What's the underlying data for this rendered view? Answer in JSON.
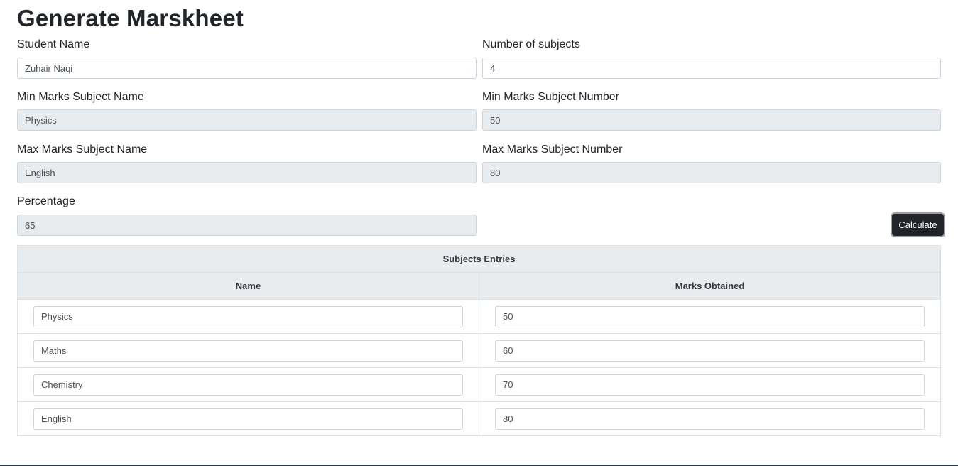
{
  "page": {
    "title": "Generate Marskheet"
  },
  "form": {
    "student_name": {
      "label": "Student Name",
      "value": "Zuhair Naqi"
    },
    "num_subjects": {
      "label": "Number of subjects",
      "value": "4"
    },
    "min_subject_name": {
      "label": "Min Marks Subject Name",
      "value": "Physics"
    },
    "min_subject_number": {
      "label": "Min Marks Subject Number",
      "value": "50"
    },
    "max_subject_name": {
      "label": "Max Marks Subject Name",
      "value": "English"
    },
    "max_subject_number": {
      "label": "Max Marks Subject Number",
      "value": "80"
    },
    "percentage": {
      "label": "Percentage",
      "value": "65"
    },
    "calculate_label": "Calculate"
  },
  "table": {
    "caption": "Subjects Entries",
    "headers": [
      "Name",
      "Marks Obtained"
    ],
    "rows": [
      {
        "name": "Physics",
        "marks": "50"
      },
      {
        "name": "Maths",
        "marks": "60"
      },
      {
        "name": "Chemistry",
        "marks": "70"
      },
      {
        "name": "English",
        "marks": "80"
      }
    ]
  }
}
